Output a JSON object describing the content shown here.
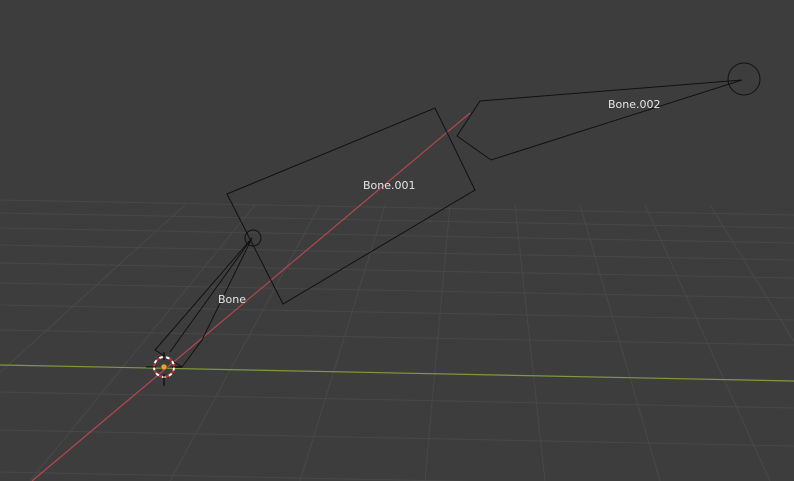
{
  "viewport": {
    "background": "#3d3d3d",
    "grid_color": "#4a4a4a",
    "x_axis_color": "#b5464f",
    "y_axis_color": "#7f9a3e"
  },
  "bones": [
    {
      "id": "bone-root",
      "label": "Bone"
    },
    {
      "id": "bone-001",
      "label": "Bone.001"
    },
    {
      "id": "bone-002",
      "label": "Bone.002"
    }
  ],
  "cursor": {
    "icon": "3d-cursor-icon"
  }
}
